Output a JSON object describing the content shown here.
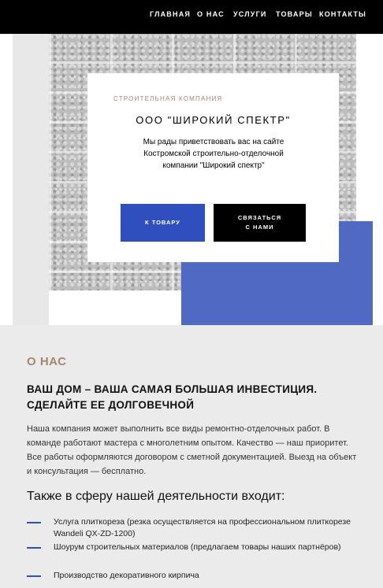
{
  "nav": {
    "items": [
      "ГЛАВНАЯ",
      "О НАС",
      "УСЛУГИ",
      "ТОВАРЫ",
      "КОНТАКТЫ"
    ]
  },
  "hero": {
    "eyebrow": "СТРОИТЕЛЬНАЯ КОМПАНИЯ",
    "title": "ООО \"ШИРОКИЙ СПЕКТР\"",
    "text": "Мы рады приветствовать вас на сайте Костромской строительно-отделочной компании \"Широкий спектр\"",
    "btn_products": "К ТОВАРУ",
    "btn_contact": "СВЯЗАТЬСЯ\nС НАМИ"
  },
  "about": {
    "heading": "О НАС",
    "subheading": "ВАШ ДОМ – ВАША САМАЯ БОЛЬШАЯ ИНВЕСТИЦИЯ. СДЕЛАЙТЕ ЕЕ ДОЛГОВЕЧНОЙ",
    "text": "Наша компания может выполнить все виды ремонтно-отделочных работ. В команде работают мастера с многолетним опытом. Качество — наш приоритет. Все работы оформляются договором с сметной документацией. Выезд на объект и консультация — бесплатно.",
    "also_heading": "Также в сферу нашей деятельности входит:",
    "list": [
      "Услуга плиткореза (резка осуществляется на профессиональном плиткорезе Wandeli QX-ZD-1200)",
      "Шоурум строительных материалов (предлагаем товары наших партнёров)",
      "Производство декоративного кирпича"
    ]
  },
  "colors": {
    "accent_blue": "#2f4fbf",
    "block_blue": "#5069c2",
    "gold": "#a5876e",
    "nav_bg": "#000000"
  }
}
